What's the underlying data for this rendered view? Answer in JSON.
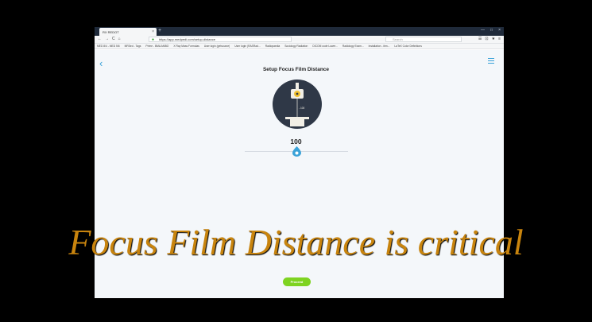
{
  "browser": {
    "tab_title": "RX REDOT",
    "tab_close": "×",
    "new_tab": "+",
    "window_controls": [
      "—",
      "□",
      "×"
    ],
    "nav_icons": [
      "←",
      "→",
      "C",
      "⌂"
    ],
    "url": "https://app.medpedi.com/setup-distance",
    "search_placeholder": "Search",
    "toolbar_icons": [
      "☰",
      "⊡",
      "★",
      "≡"
    ],
    "bookmarks": [
      "MED 8/4 - MED 5/6",
      "MRSed - Tags",
      "Prime - BMA AMBO",
      "X Ray Mass Formulas",
      "User login (getsource)",
      "User login (RASRad...",
      "Radiopaedia",
      "Sociology Radiation",
      "DICOM code Lower...",
      "Radiology Exam...",
      "Installation - ibm...",
      "LaTeX Color Definitions"
    ]
  },
  "app": {
    "title": "Setup Focus Film Distance",
    "ffd_value": "100",
    "slider": {
      "value": 100,
      "fraction": 0.46
    },
    "proceed_label": "Proceed",
    "illustration_label": "- 100"
  },
  "overlay": {
    "caption": "Focus Film Distance is critical"
  },
  "colors": {
    "accent": "#3aa2d8",
    "proceed_green": "#7ed321",
    "caption_orange": "#c8840e",
    "illustration_bg": "#2f3847",
    "content_bg": "#f4f7fa"
  }
}
